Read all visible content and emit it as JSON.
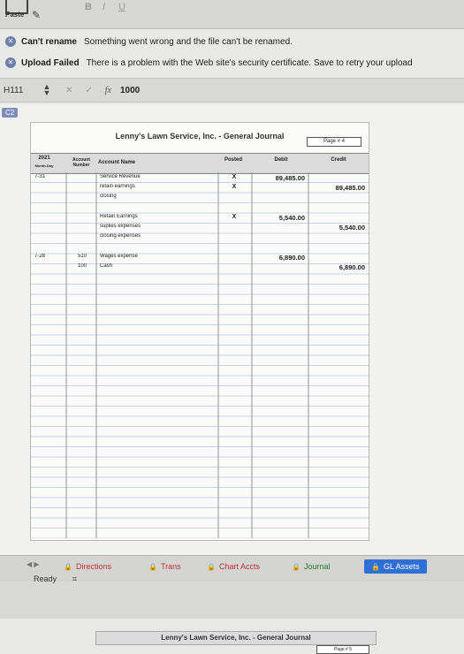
{
  "toolbar": {
    "paste_label": "Paste",
    "bold_label": "B",
    "italic_label": "I",
    "underline_label": "U"
  },
  "notifications": [
    {
      "title": "Can't rename",
      "message": "Something went wrong and the file can't be renamed."
    },
    {
      "title": "Upload Failed",
      "message": "There is a problem with the Web site's security certificate. Save to retry your upload"
    }
  ],
  "formula_bar": {
    "cell_name": "H111",
    "fx_label": "fx",
    "value": "1000"
  },
  "sheet": {
    "active_cell_ref": "C2",
    "journal": {
      "title": "Lenny's Lawn Service, Inc.  - General Journal",
      "page_label": "Page # 4",
      "headers": {
        "year": "2021",
        "date_sub": "Month-Day",
        "account_number": "Account Number",
        "account_name": "Account Name",
        "posted": "Posted",
        "debit": "Debit",
        "credit": "Credit"
      },
      "rows": [
        {
          "date": "7-31",
          "acct": "",
          "name": "Service Revenue",
          "posted": "X",
          "debit": "89,485.00",
          "credit": ""
        },
        {
          "date": "",
          "acct": "",
          "name": "retain earnings",
          "posted": "X",
          "debit": "",
          "credit": "89,485.00"
        },
        {
          "date": "",
          "acct": "",
          "name": "closing",
          "posted": "",
          "debit": "",
          "credit": ""
        },
        {
          "date": "",
          "acct": "",
          "name": "Retain Earnings",
          "posted": "X",
          "debit": "5,540.00",
          "credit": ""
        },
        {
          "date": "",
          "acct": "",
          "name": "suplies expenses",
          "posted": "",
          "debit": "",
          "credit": "5,540.00"
        },
        {
          "date": "",
          "acct": "",
          "name": "closing expenses",
          "posted": "",
          "debit": "",
          "credit": ""
        },
        {
          "date": "7-28",
          "acct": "510",
          "name": "Wages expense",
          "posted": "",
          "debit": "6,890.00",
          "credit": ""
        },
        {
          "date": "",
          "acct": "100",
          "name": "Cash",
          "posted": "",
          "debit": "",
          "credit": "6,890.00"
        }
      ]
    },
    "next_journal": {
      "title": "Lenny's Lawn Service, Inc.  - General Journal",
      "page_label": "Page # 5"
    }
  },
  "sheet_tabs": [
    {
      "label": "Directions"
    },
    {
      "label": "Trans"
    },
    {
      "label": "Chart Accts"
    },
    {
      "label": "Journal"
    },
    {
      "label": "GL Assets",
      "active": true
    }
  ],
  "status": {
    "text": "Ready"
  }
}
